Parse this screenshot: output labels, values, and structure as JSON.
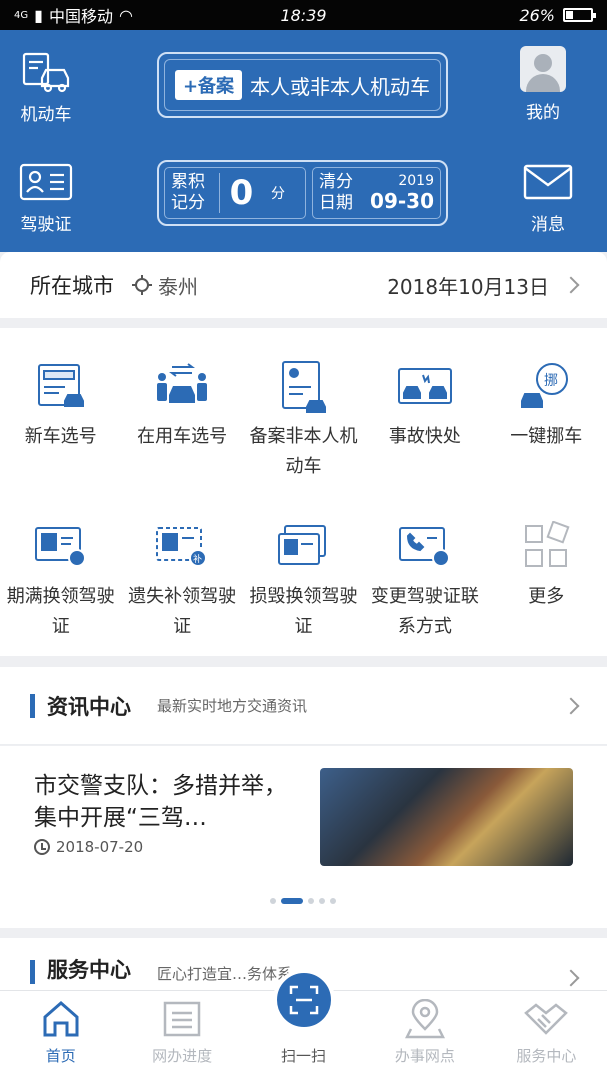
{
  "status": {
    "carrier": "中国移动",
    "network": "4G",
    "time": "18:39",
    "battery": "26%"
  },
  "header": {
    "vehicle_label": "机动车",
    "license_label": "驾驶证",
    "mine_label": "我的",
    "message_label": "消息",
    "record_tag": "+备案",
    "record_text": "本人或非本人机动车",
    "points_label": "累积记分",
    "points_value": "0",
    "points_unit": "分",
    "clear_label": "清分日期",
    "clear_year": "2019",
    "clear_md": "09-30"
  },
  "city": {
    "label": "所在城市",
    "name": "泰州",
    "date": "2018年10月13日"
  },
  "services": [
    {
      "label": "新车选号",
      "icon": "plate-icon"
    },
    {
      "label": "在用车选号",
      "icon": "car-exchange-icon"
    },
    {
      "label": "备案非本人机动车",
      "icon": "record-doc-icon"
    },
    {
      "label": "事故快处",
      "icon": "accident-icon"
    },
    {
      "label": "一键挪车",
      "icon": "move-car-icon"
    },
    {
      "label": "期满换领驾驶证",
      "icon": "license-renew-icon"
    },
    {
      "label": "遗失补领驾驶证",
      "icon": "license-reissue-icon"
    },
    {
      "label": "损毁换领驾驶证",
      "icon": "license-damaged-icon"
    },
    {
      "label": "变更驾驶证联系方式",
      "icon": "contact-change-icon"
    },
    {
      "label": "更多",
      "icon": "more-grid-icon"
    }
  ],
  "news": {
    "title": "资讯中心",
    "subtitle": "最新实时地方交通资讯",
    "item_title": "市交警支队：多措并举，集中开展“三驾…",
    "item_date": "2018-07-20"
  },
  "service_center": {
    "title": "服务中心",
    "subtitle": "匠心打造宜…务体系"
  },
  "tabs": [
    {
      "label": "首页",
      "active": true
    },
    {
      "label": "网办进度",
      "active": false
    },
    {
      "label": "扫一扫",
      "active": false
    },
    {
      "label": "办事网点",
      "active": false
    },
    {
      "label": "服务中心",
      "active": false
    }
  ],
  "colors": {
    "primary": "#2c6bb5",
    "inactive": "#b4b8be"
  }
}
